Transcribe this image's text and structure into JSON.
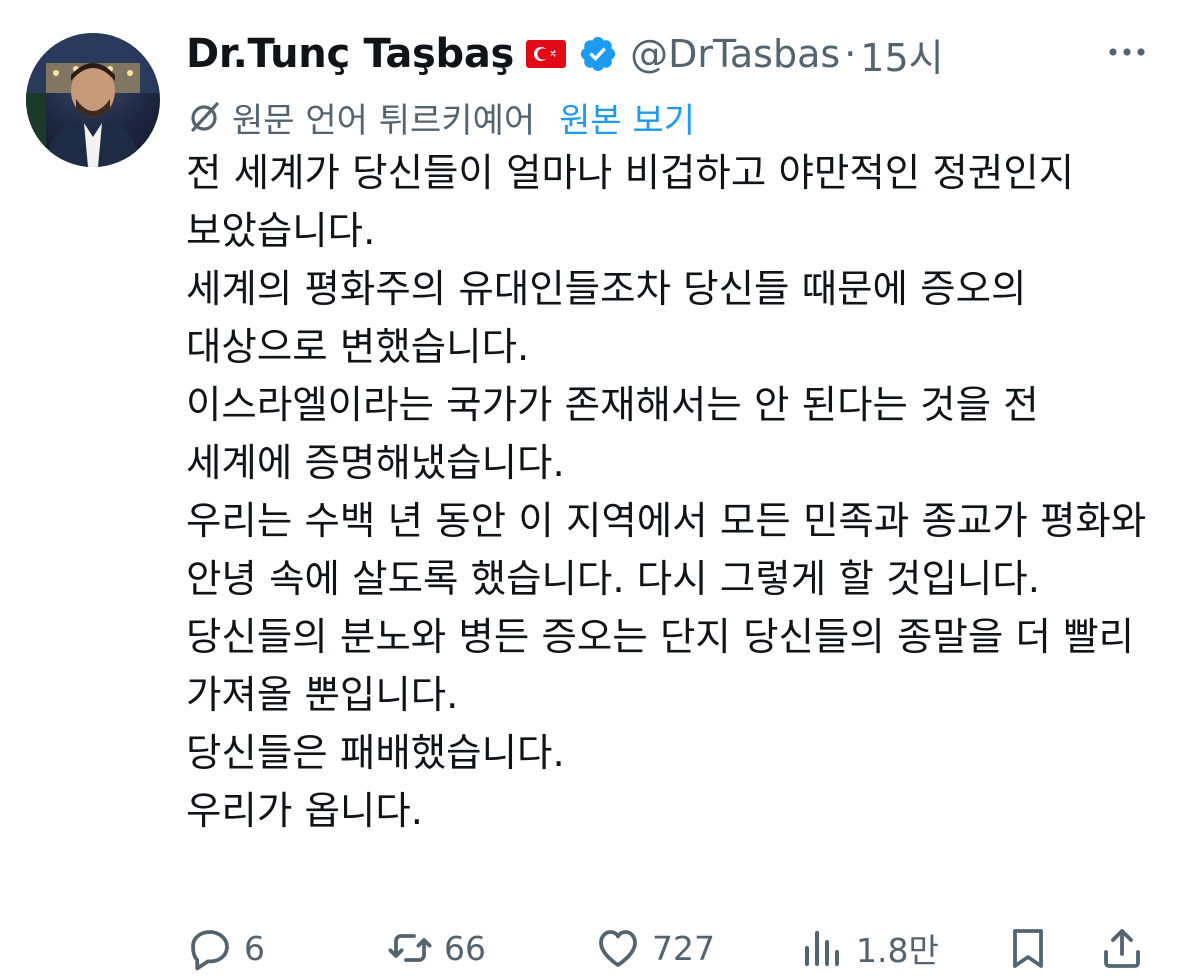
{
  "author": {
    "display_name": "Dr.Tunç Taşbaş",
    "handle": "@DrTasbas",
    "separator": "·",
    "timestamp": "15시"
  },
  "translation": {
    "label": "원문 언어 튀르키예어",
    "view_original": "원본 보기"
  },
  "tweet_text": "전 세계가 당신들이 얼마나 비겁하고 야만적인 정권인지 보았습니다.\n세계의 평화주의 유대인들조차 당신들 때문에 증오의 대상으로 변했습니다.\n이스라엘이라는 국가가 존재해서는 안 된다는 것을 전 세계에 증명해냈습니다.\n우리는 수백 년 동안 이 지역에서 모든 민족과 종교가 평화와 안녕 속에 살도록 했습니다. 다시 그렇게 할 것입니다.\n당신들의 분노와 병든 증오는 단지 당신들의 종말을 더 빨리 가져올 뿐입니다.\n당신들은 패배했습니다.\n우리가 옵니다.",
  "actions": {
    "reply_count": "6",
    "retweet_count": "66",
    "like_count": "727",
    "views_count": "1.8만"
  },
  "icons": {
    "flag": "turkey-flag-icon",
    "verified": "verified-badge-icon",
    "more": "more-icon",
    "translate": "translate-icon",
    "reply": "reply-icon",
    "retweet": "retweet-icon",
    "like": "like-icon",
    "views": "views-icon",
    "bookmark": "bookmark-icon",
    "share": "share-icon"
  },
  "colors": {
    "text": "#0f1419",
    "secondary": "#536471",
    "link": "#1d9bf0",
    "verified": "#1d9bf0",
    "flag_red": "#e30a17"
  }
}
